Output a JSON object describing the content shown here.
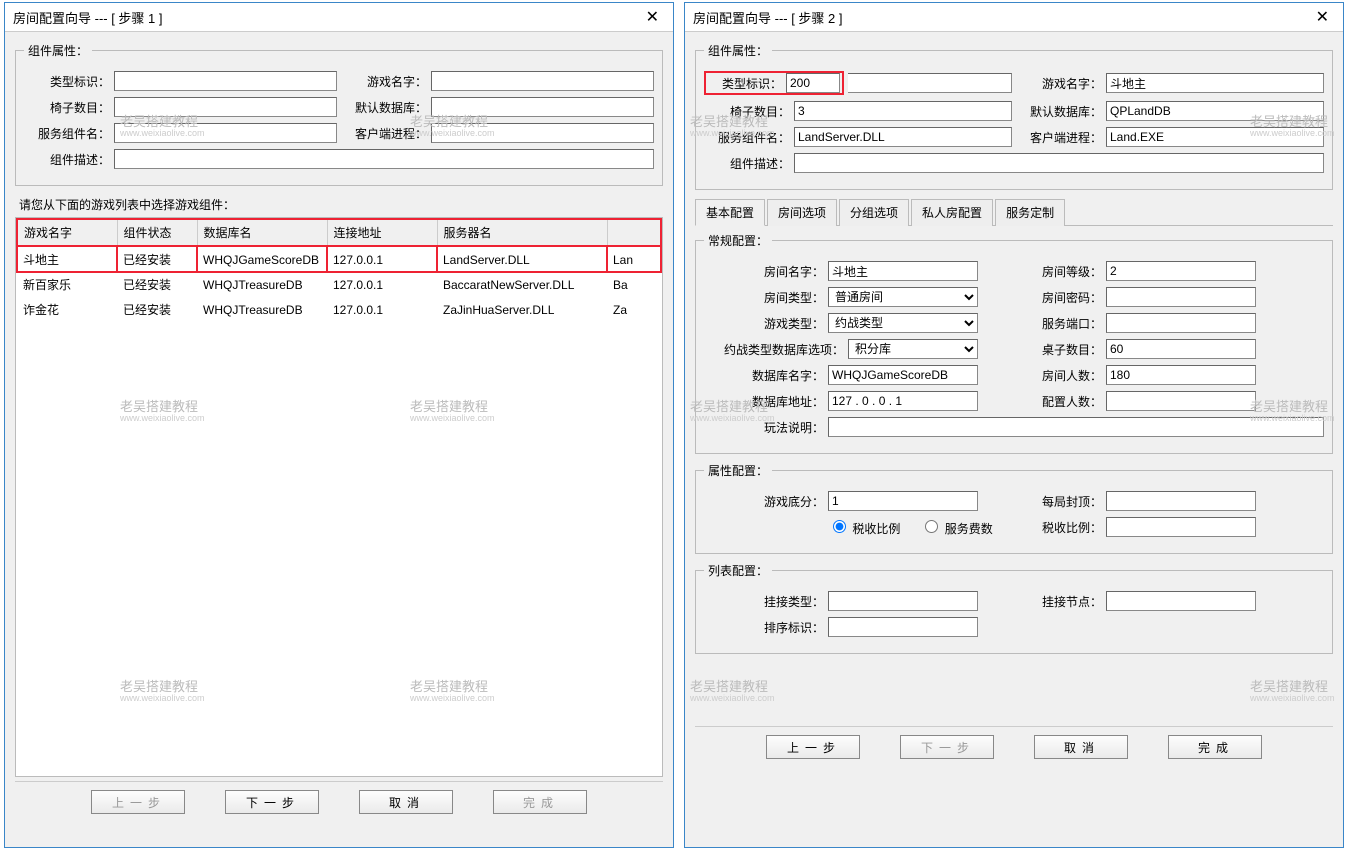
{
  "watermark": {
    "line1": "老吴搭建教程",
    "line2": "www.weixiaolive.com"
  },
  "dialog1": {
    "title": "房间配置向导 --- [ 步骤 1 ]",
    "group_title": "组件属性：",
    "labels": {
      "type_id": "类型标识：",
      "game_name": "游戏名字：",
      "chair_count": "椅子数目：",
      "default_db": "默认数据库：",
      "service_module": "服务组件名：",
      "client_proc": "客户端进程：",
      "desc": "组件描述："
    },
    "instruction": "请您从下面的游戏列表中选择游戏组件：",
    "columns": [
      "游戏名字",
      "组件状态",
      "数据库名",
      "连接地址",
      "服务器名",
      ""
    ],
    "rows": [
      {
        "c": [
          "斗地主",
          "已经安装",
          "WHQJGameScoreDB",
          "127.0.0.1",
          "LandServer.DLL",
          "Lan"
        ]
      },
      {
        "c": [
          "新百家乐",
          "已经安装",
          "WHQJTreasureDB",
          "127.0.0.1",
          "BaccaratNewServer.DLL",
          "Ba"
        ]
      },
      {
        "c": [
          "诈金花",
          "已经安装",
          "WHQJTreasureDB",
          "127.0.0.1",
          "ZaJinHuaServer.DLL",
          "Za"
        ]
      }
    ],
    "buttons": {
      "prev": "上一步",
      "next": "下一步",
      "cancel": "取消",
      "finish": "完成"
    }
  },
  "dialog2": {
    "title": "房间配置向导 --- [ 步骤 2 ]",
    "group_title": "组件属性：",
    "labels": {
      "type_id": "类型标识：",
      "game_name": "游戏名字：",
      "chair_count": "椅子数目：",
      "default_db": "默认数据库：",
      "service_module": "服务组件名：",
      "client_proc": "客户端进程：",
      "desc": "组件描述："
    },
    "values": {
      "type_id": "200",
      "game_name": "斗地主",
      "chair_count": "3",
      "default_db": "QPLandDB",
      "service_module": "LandServer.DLL",
      "client_proc": "Land.EXE",
      "desc": ""
    },
    "tabs": [
      "基本配置",
      "房间选项",
      "分组选项",
      "私人房配置",
      "服务定制"
    ],
    "sections": {
      "general": "常规配置：",
      "attr": "属性配置：",
      "list": "列表配置："
    },
    "gen_labels": {
      "room_name": "房间名字：",
      "room_level": "房间等级：",
      "room_type": "房间类型：",
      "room_pwd": "房间密码：",
      "game_type": "游戏类型：",
      "svc_port": "服务端口：",
      "db_opt": "约战类型数据库选项：",
      "table_count": "桌子数目：",
      "db_name": "数据库名字：",
      "room_people": "房间人数：",
      "db_addr": "数据库地址：",
      "cfg_people": "配置人数：",
      "rule": "玩法说明："
    },
    "gen_values": {
      "room_name": "斗地主",
      "room_level": "2",
      "room_type": "普通房间",
      "room_pwd": "",
      "game_type": "约战类型",
      "svc_port": "",
      "db_opt": "积分库",
      "table_count": "60",
      "db_name": "WHQJGameScoreDB",
      "room_people": "180",
      "db_addr": "127 . 0 . 0 . 1",
      "cfg_people": "",
      "rule": ""
    },
    "attr_labels": {
      "base_score": "游戏底分：",
      "cap": "每局封顶：",
      "tax_ratio_rb": "税收比例",
      "fee_rb": "服务费数",
      "tax_ratio": "税收比例："
    },
    "attr_values": {
      "base_score": "1",
      "cap": "",
      "tax_ratio": ""
    },
    "list_labels": {
      "mount_type": "挂接类型：",
      "mount_node": "挂接节点：",
      "sort_id": "排序标识："
    },
    "buttons": {
      "prev": "上一步",
      "next": "下一步",
      "cancel": "取消",
      "finish": "完成"
    }
  }
}
